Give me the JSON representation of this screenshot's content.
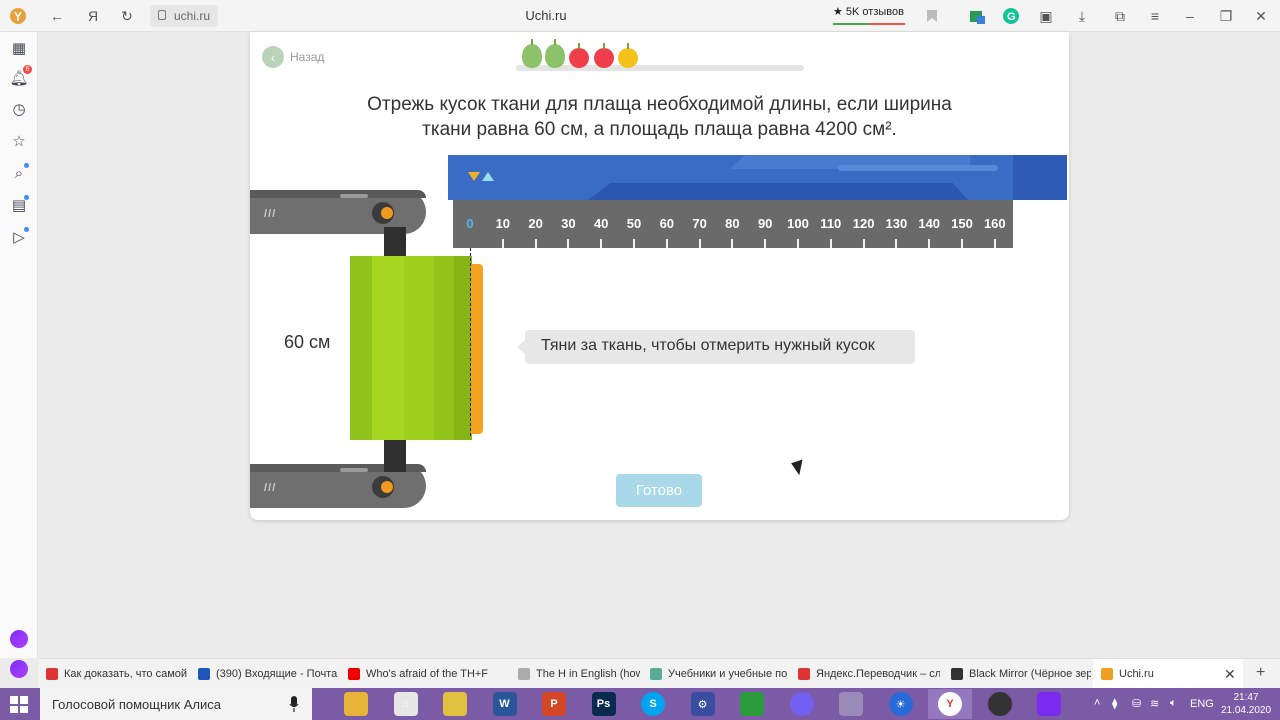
{
  "browser": {
    "url": "uchi.ru",
    "title": "Uchi.ru",
    "reviews_label": "★ 5K отзывов",
    "yandex_label": "Я"
  },
  "sidebar": {
    "badge_count": "6"
  },
  "lesson": {
    "back_label": "Назад",
    "progress_fruits": [
      "pear",
      "pear",
      "apple",
      "apple",
      "orange"
    ],
    "task_text_line1": "Отрежь кусок ткани для плаща необходимой длины, если ширина",
    "task_text_line2": "ткани равна 60 см, а площадь плаща равна 4200 см².",
    "width_label": "60 см",
    "ruler_labels": [
      "0",
      "10",
      "20",
      "30",
      "40",
      "50",
      "60",
      "70",
      "80",
      "90",
      "100",
      "110",
      "120",
      "130",
      "140",
      "150",
      "160"
    ],
    "hint": "Тяни за ткань, чтобы отмерить нужный кусок",
    "done_label": "Готово",
    "colors": {
      "ruler_blue": "#3a6bc5",
      "fabric_green": "#9acd20",
      "accent_orange": "#f4a21f",
      "done_button": "#a9d8e8",
      "zero_label": "#5ab8e8"
    }
  },
  "tabs": [
    {
      "label": "Как доказать, что самой",
      "color": "#d33"
    },
    {
      "label": "(390) Входящие - Почта",
      "color": "#1f57b8"
    },
    {
      "label": "Who's afraid of the TH+F",
      "color": "#e00"
    },
    {
      "label": "The H in English (how to",
      "color": "#aaa"
    },
    {
      "label": "Учебники и учебные по",
      "color": "#5a9"
    },
    {
      "label": "Яндекс.Переводчик – сл",
      "color": "#d33"
    },
    {
      "label": "Black Mirror (Чёрное зер",
      "color": "#333"
    },
    {
      "label": "Uchi.ru",
      "color": "#f0a020"
    }
  ],
  "taskbar": {
    "search_placeholder": "Голосовой помощник Алиса",
    "lang": "ENG",
    "time": "21:47",
    "date": "21.04.2020",
    "apps": [
      {
        "name": "file-explorer",
        "label": "",
        "color": "#e8b438"
      },
      {
        "name": "home",
        "label": "⌂",
        "color": "#e6e6e6"
      },
      {
        "name": "files",
        "label": "",
        "color": "#e2c040"
      },
      {
        "name": "word",
        "label": "W",
        "color": "#2b579a"
      },
      {
        "name": "powerpoint",
        "label": "P",
        "color": "#d24726"
      },
      {
        "name": "photoshop",
        "label": "Ps",
        "color": "#0a2a4f"
      },
      {
        "name": "skype",
        "label": "S",
        "color": "#00a4ef"
      },
      {
        "name": "settings",
        "label": "⚙",
        "color": "#3a4da0"
      },
      {
        "name": "cloud-app",
        "label": "",
        "color": "#2a9a3a"
      },
      {
        "name": "viber",
        "label": "",
        "color": "#7360f2"
      },
      {
        "name": "paint",
        "label": "",
        "color": "#9a8ab8"
      },
      {
        "name": "weather",
        "label": "☀",
        "color": "#2a6ad8"
      },
      {
        "name": "yandex-browser",
        "label": "Y",
        "color": "#ffffff"
      },
      {
        "name": "obs",
        "label": "",
        "color": "#333333"
      },
      {
        "name": "search-app",
        "label": "",
        "color": "#7b2cf0"
      }
    ]
  }
}
